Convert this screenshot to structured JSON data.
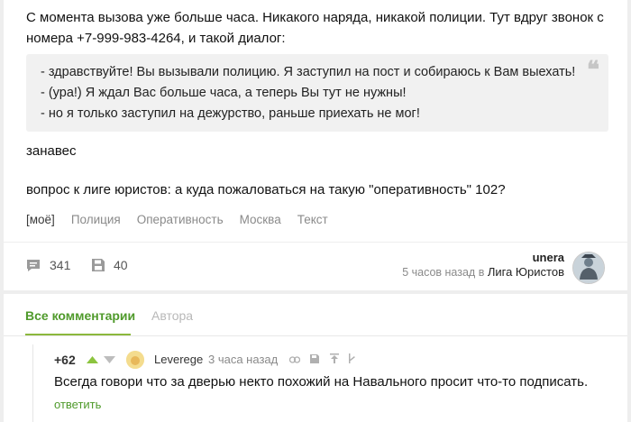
{
  "post": {
    "intro": "С момента вызова уже больше часа. Никакого наряда, никакой полиции. Тут вдруг звонок с номера +7-999-983-4264, и такой диалог:",
    "quote_lines": [
      "- здравствуйте! Вы вызывали полицию. Я заступил на пост и собираюсь к Вам выехать!",
      "- (ура!) Я ждал Вас больше часа, а теперь Вы тут не нужны!",
      "- но я только заступил на дежурство, раньше приехать не мог!"
    ],
    "quote_mark": "❝",
    "curtain": "занавес",
    "question": "вопрос к лиге юристов: а куда пожаловаться на такую \"оперативность\" 102?",
    "tags": [
      "[моё]",
      "Полиция",
      "Оперативность",
      "Москва",
      "Текст"
    ],
    "comments_count": "341",
    "saves_count": "40",
    "author": "unera",
    "time_ago": "5 часов назад в",
    "community": "Лига Юристов"
  },
  "comments_section": {
    "tabs": [
      "Все комментарии",
      "Автора"
    ],
    "comment": {
      "rating": "+62",
      "author": "Leverege",
      "time": "3 часа назад",
      "text": "Всегда говори что за дверью некто похожий на Навального просит что-то подписать.",
      "reply": "ответить"
    }
  },
  "colors": {
    "accent_green": "#4f9a2b",
    "upvote_green": "#8cc43f",
    "background": "#eeeeee"
  }
}
